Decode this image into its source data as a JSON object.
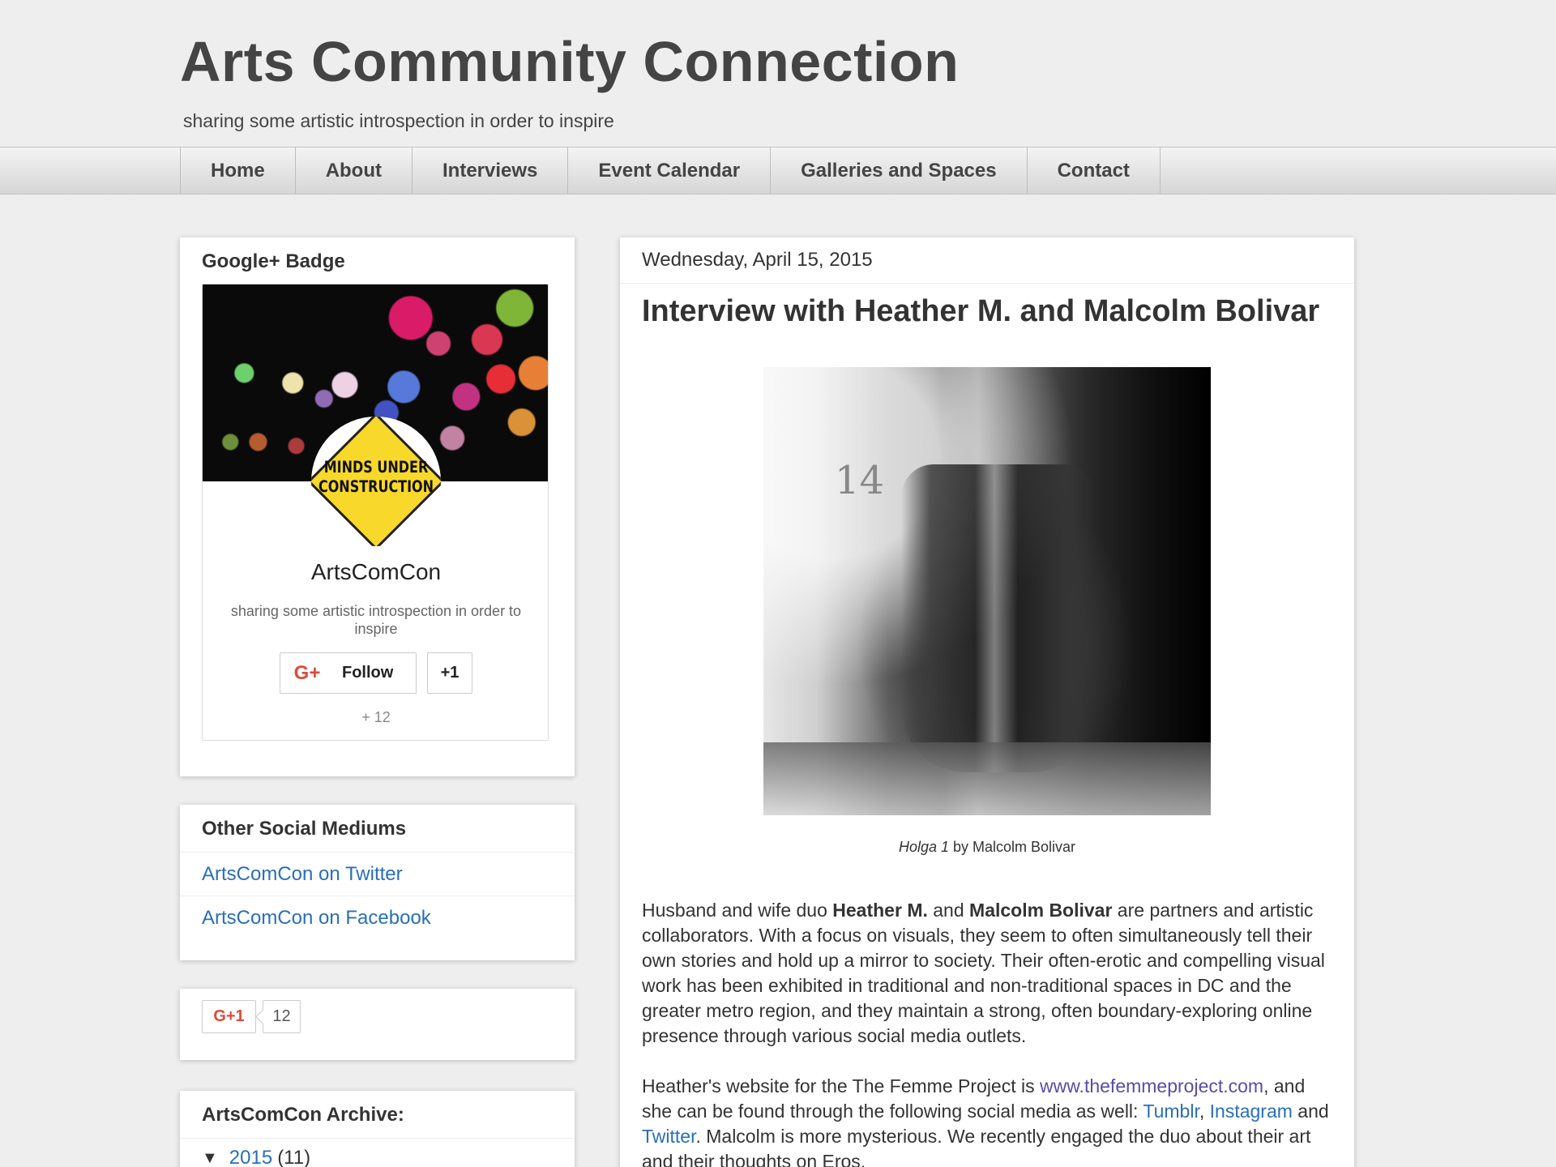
{
  "header": {
    "title": "Arts Community Connection",
    "description": "sharing some artistic introspection in order to inspire"
  },
  "nav": {
    "items": [
      {
        "label": "Home"
      },
      {
        "label": "About"
      },
      {
        "label": "Interviews"
      },
      {
        "label": "Event Calendar"
      },
      {
        "label": "Galleries and Spaces"
      },
      {
        "label": "Contact"
      }
    ]
  },
  "sidebar": {
    "gplus_badge": {
      "title": "Google+ Badge",
      "avatar_text": "MINDS UNDER CONSTRUCTION",
      "name": "ArtsComCon",
      "tagline": "sharing some artistic introspection in order to inspire",
      "follow_icon": "G+",
      "follow_label": "Follow",
      "plusone_label": "+1",
      "count": "+ 12"
    },
    "social": {
      "title": "Other Social Mediums",
      "links": [
        {
          "label": "ArtsComCon on Twitter"
        },
        {
          "label": "ArtsComCon on Facebook"
        }
      ]
    },
    "plusone": {
      "label": "G+1",
      "count": "12"
    },
    "archive": {
      "title": "ArtsComCon Archive:",
      "arrow": "▼",
      "year": "2015",
      "count": "(11)"
    }
  },
  "post": {
    "date": "Wednesday, April 15, 2015",
    "title": "Interview with Heather M. and Malcolm Bolivar",
    "image_text": "14",
    "caption_title": "Holga 1",
    "caption_rest": " by Malcolm Bolivar",
    "p1": {
      "t1": "Husband and wife duo ",
      "b1": "Heather M.",
      "t2": " and ",
      "b2": "Malcolm Bolivar",
      "t3": " are partners and artistic collaborators. With a focus on visuals, they seem to often simultaneously tell their own stories and hold up a mirror to society. Their often-erotic and compelling visual work has been exhibited in traditional and non-traditional spaces in DC and the greater metro region, and they maintain a strong, often boundary-exploring online presence through various social media outlets."
    },
    "p2": {
      "t1": "Heather's website for the The Femme Project is ",
      "link1": "www.thefemmeproject.com",
      "t2": ", and she can be found through the following social media as well: ",
      "link2": "Tumblr",
      "t3": ", ",
      "link3": "Instagram",
      "t4": " and ",
      "link4": "Twitter",
      "t5": ". Malcolm is more mysterious. We recently engaged the duo about their art and their thoughts on Eros."
    }
  }
}
